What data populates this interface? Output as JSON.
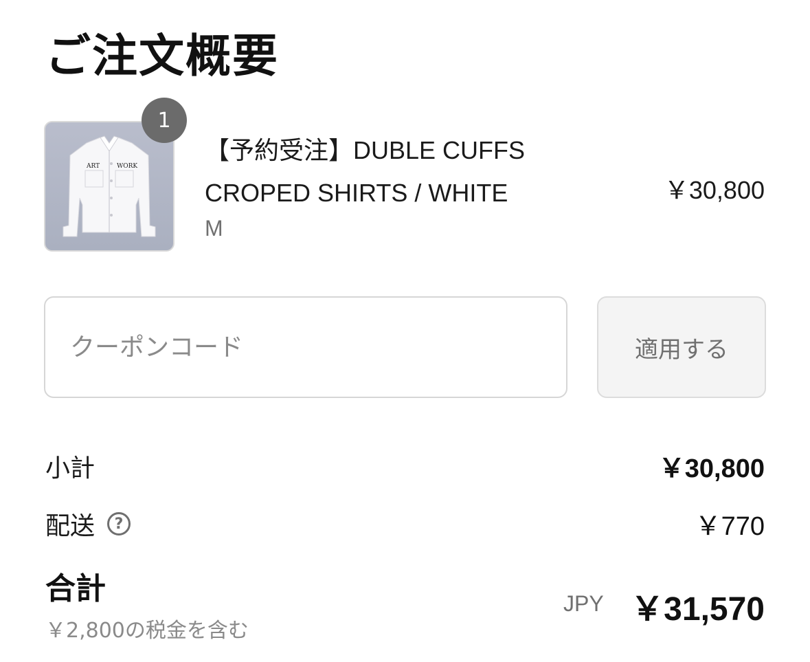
{
  "header": {
    "title": "ご注文概要"
  },
  "product": {
    "quantity": "1",
    "name": "【予約受注】DUBLE CUFFS CROPED SHIRTS / WHITE",
    "variant": "M",
    "price": "￥30,800",
    "image_text_left": "ART",
    "image_text_right": "WORK"
  },
  "coupon": {
    "placeholder": "クーポンコード",
    "apply_label": "適用する"
  },
  "summary": {
    "subtotal_label": "小計",
    "subtotal_value": "￥30,800",
    "shipping_label": "配送",
    "shipping_help_icon": "?",
    "shipping_value": "￥770",
    "total_label": "合計",
    "tax_note": "￥2,800の税金を含む",
    "currency": "JPY",
    "total_value": "￥31,570"
  }
}
